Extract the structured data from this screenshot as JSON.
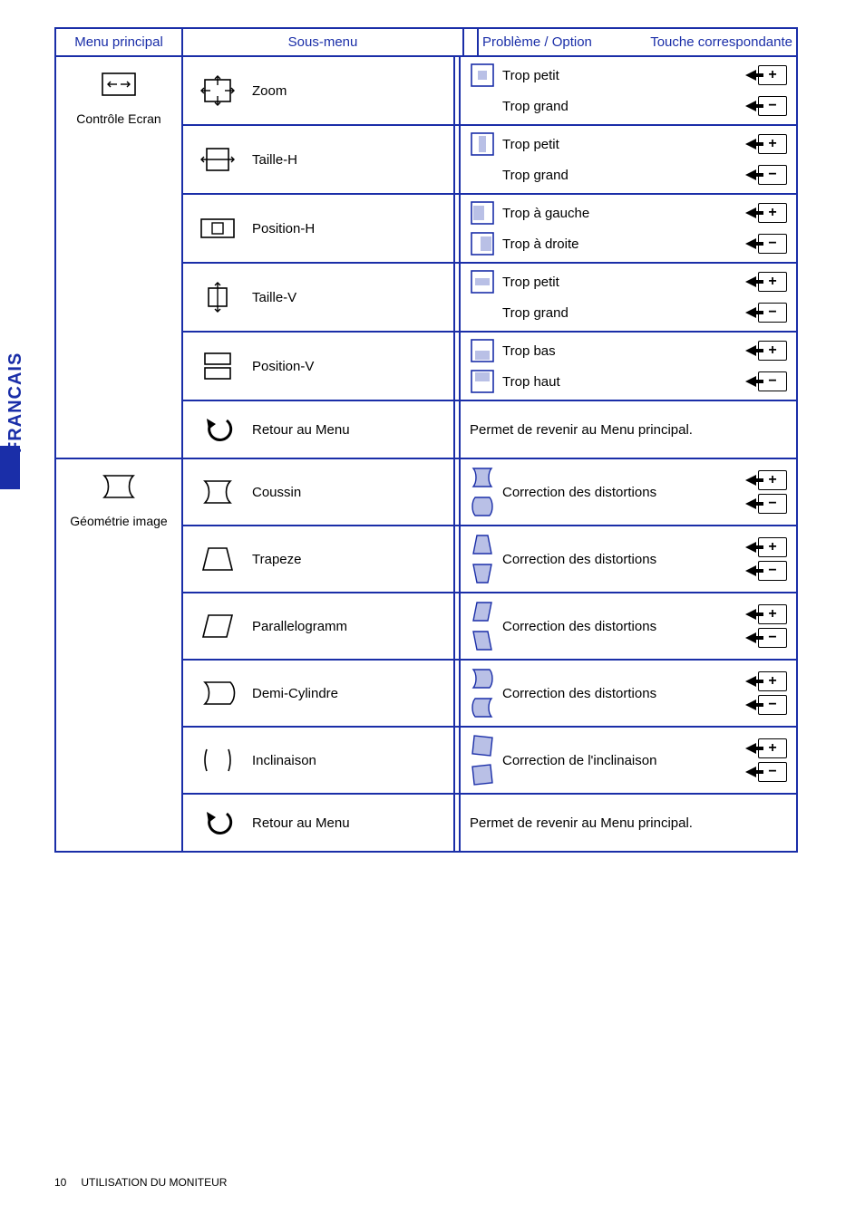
{
  "side_label": "FRANCAIS",
  "headers": {
    "main": "Menu principal",
    "sub": "Sous-menu",
    "problem": "Problème / Option",
    "key": "Touche correspondante"
  },
  "keys": {
    "plus": "+",
    "minus": "−"
  },
  "sections": [
    {
      "main_label": "Contrôle Ecran",
      "rows": [
        {
          "sub_label": "Zoom",
          "problems": [
            {
              "text": "Trop petit",
              "key": "plus"
            },
            {
              "text": "Trop grand",
              "key": "minus"
            }
          ]
        },
        {
          "sub_label": "Taille-H",
          "problems": [
            {
              "text": "Trop petit",
              "key": "plus"
            },
            {
              "text": "Trop grand",
              "key": "minus"
            }
          ]
        },
        {
          "sub_label": "Position-H",
          "problems": [
            {
              "text": "Trop à gauche",
              "key": "plus"
            },
            {
              "text": "Trop à droite",
              "key": "minus"
            }
          ]
        },
        {
          "sub_label": "Taille-V",
          "problems": [
            {
              "text": "Trop petit",
              "key": "plus"
            },
            {
              "text": "Trop grand",
              "key": "minus"
            }
          ]
        },
        {
          "sub_label": "Position-V",
          "problems": [
            {
              "text": "Trop bas",
              "key": "plus"
            },
            {
              "text": "Trop haut",
              "key": "minus"
            }
          ]
        },
        {
          "sub_label": "Retour au Menu",
          "return_text": "Permet de revenir au Menu principal."
        }
      ]
    },
    {
      "main_label": "Géométrie image",
      "rows": [
        {
          "sub_label": "Coussin",
          "single_text": "Correction des distortions",
          "pm_pair": true
        },
        {
          "sub_label": "Trapeze",
          "single_text": "Correction des distortions",
          "pm_pair": true
        },
        {
          "sub_label": "Parallelogramm",
          "single_text": "Correction des distortions",
          "pm_pair": true
        },
        {
          "sub_label": "Demi-Cylindre",
          "single_text": "Correction des distortions",
          "pm_pair": true
        },
        {
          "sub_label": "Inclinaison",
          "single_text": "Correction de l'inclinaison",
          "pm_pair": true
        },
        {
          "sub_label": "Retour au Menu",
          "return_text": "Permet de revenir au Menu principal."
        }
      ]
    }
  ],
  "footer": {
    "page": "10",
    "title": "UTILISATION DU MONITEUR"
  }
}
